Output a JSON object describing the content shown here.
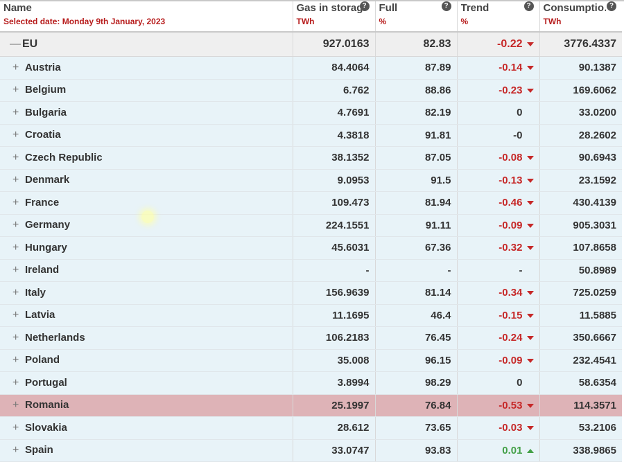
{
  "header": {
    "name_label": "Name",
    "selected_date": "Selected date: Monday 9th January, 2023",
    "storage_label": "Gas in storage",
    "storage_unit": "TWh",
    "full_label": "Full",
    "full_unit": "%",
    "trend_label": "Trend",
    "trend_unit": "%",
    "consumption_label": "Consumptio…",
    "consumption_unit": "TWh",
    "help_glyph": "?"
  },
  "eu_row": {
    "name": "EU",
    "expander": "—",
    "storage": "927.0163",
    "full": "82.83",
    "trend": "-0.22",
    "trend_dir": "down",
    "consumption": "3776.4337"
  },
  "rows": [
    {
      "name": "Austria",
      "expander": "+",
      "storage": "84.4064",
      "full": "87.89",
      "trend": "-0.14",
      "trend_dir": "down",
      "consumption": "90.1387"
    },
    {
      "name": "Belgium",
      "expander": "+",
      "storage": "6.762",
      "full": "88.86",
      "trend": "-0.23",
      "trend_dir": "down",
      "consumption": "169.6062"
    },
    {
      "name": "Bulgaria",
      "expander": "+",
      "storage": "4.7691",
      "full": "82.19",
      "trend": "0",
      "trend_dir": "flat",
      "consumption": "33.0200"
    },
    {
      "name": "Croatia",
      "expander": "+",
      "storage": "4.3818",
      "full": "91.81",
      "trend": "-0",
      "trend_dir": "flat",
      "consumption": "28.2602"
    },
    {
      "name": "Czech Republic",
      "expander": "+",
      "storage": "38.1352",
      "full": "87.05",
      "trend": "-0.08",
      "trend_dir": "down",
      "consumption": "90.6943"
    },
    {
      "name": "Denmark",
      "expander": "+",
      "storage": "9.0953",
      "full": "91.5",
      "trend": "-0.13",
      "trend_dir": "down",
      "consumption": "23.1592"
    },
    {
      "name": "France",
      "expander": "+",
      "storage": "109.473",
      "full": "81.94",
      "trend": "-0.46",
      "trend_dir": "down",
      "consumption": "430.4139"
    },
    {
      "name": "Germany",
      "expander": "+",
      "storage": "224.1551",
      "full": "91.11",
      "trend": "-0.09",
      "trend_dir": "down",
      "consumption": "905.3031"
    },
    {
      "name": "Hungary",
      "expander": "+",
      "storage": "45.6031",
      "full": "67.36",
      "trend": "-0.32",
      "trend_dir": "down",
      "consumption": "107.8658"
    },
    {
      "name": "Ireland",
      "expander": "+",
      "storage": "-",
      "full": "-",
      "trend": "-",
      "trend_dir": "flat",
      "consumption": "50.8989"
    },
    {
      "name": "Italy",
      "expander": "+",
      "storage": "156.9639",
      "full": "81.14",
      "trend": "-0.34",
      "trend_dir": "down",
      "consumption": "725.0259"
    },
    {
      "name": "Latvia",
      "expander": "+",
      "storage": "11.1695",
      "full": "46.4",
      "trend": "-0.15",
      "trend_dir": "down",
      "consumption": "11.5885"
    },
    {
      "name": "Netherlands",
      "expander": "+",
      "storage": "106.2183",
      "full": "76.45",
      "trend": "-0.24",
      "trend_dir": "down",
      "consumption": "350.6667"
    },
    {
      "name": "Poland",
      "expander": "+",
      "storage": "35.008",
      "full": "96.15",
      "trend": "-0.09",
      "trend_dir": "down",
      "consumption": "232.4541"
    },
    {
      "name": "Portugal",
      "expander": "+",
      "storage": "3.8994",
      "full": "98.29",
      "trend": "0",
      "trend_dir": "flat",
      "consumption": "58.6354"
    },
    {
      "name": "Romania",
      "expander": "+",
      "storage": "25.1997",
      "full": "76.84",
      "trend": "-0.53",
      "trend_dir": "down",
      "consumption": "114.3571",
      "highlighted": true
    },
    {
      "name": "Slovakia",
      "expander": "+",
      "storage": "28.612",
      "full": "73.65",
      "trend": "-0.03",
      "trend_dir": "down",
      "consumption": "53.2106"
    },
    {
      "name": "Spain",
      "expander": "+",
      "storage": "33.0747",
      "full": "93.83",
      "trend": "0.01",
      "trend_dir": "up",
      "consumption": "338.9865"
    }
  ],
  "colors": {
    "accent": "#b71c1c",
    "negative": "#c62828",
    "positive": "#43a047",
    "row_bg": "#e8f3f8",
    "highlight_bg": "#deb3b7"
  }
}
